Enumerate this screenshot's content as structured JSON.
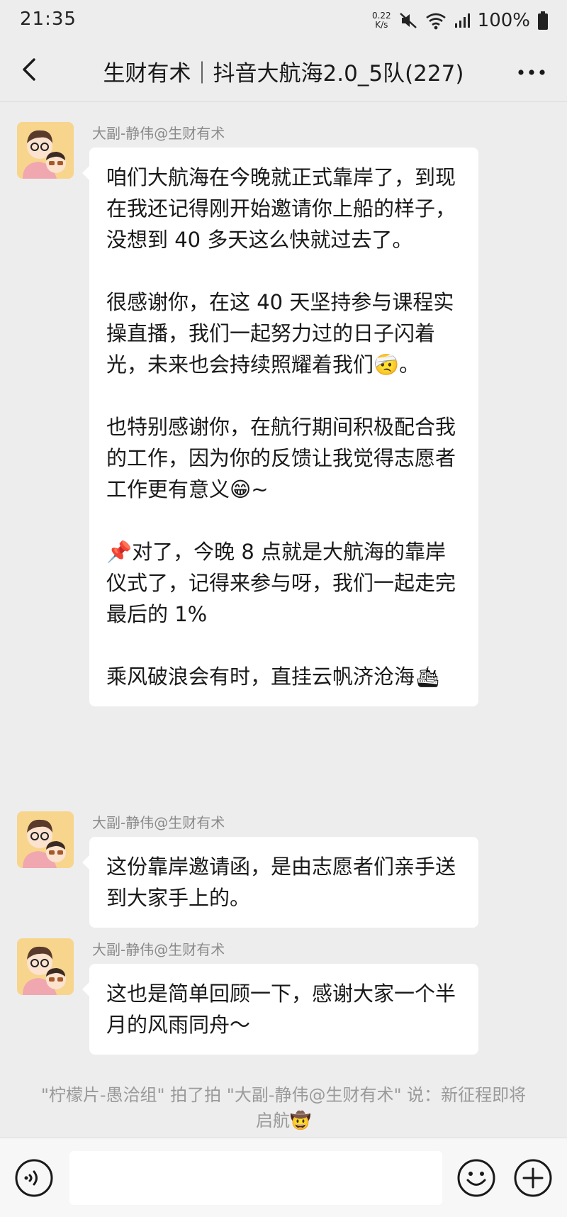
{
  "status_bar": {
    "time": "21:35",
    "net_speed_value": "0.22",
    "net_speed_unit": "K/s",
    "battery": "100%"
  },
  "header": {
    "title": "生财有术｜抖音大航海2.0_5队(227)"
  },
  "messages": [
    {
      "sender": "大副-静伟@生财有术",
      "paragraphs": [
        "咱们大航海在今晚就正式靠岸了，到现在我还记得刚开始邀请你上船的样子，没想到 40 多天这么快就过去了。",
        "很感谢你，在这 40 天坚持参与课程实操直播，我们一起努力过的日子闪着光，未来也会持续照耀着我们🤕。",
        "也特别感谢你，在航行期间积极配合我的工作，因为你的反馈让我觉得志愿者工作更有意义😁~",
        "📌对了，今晚 8 点就是大航海的靠岸仪式了，记得来参与呀，我们一起走完最后的 1%",
        "乘风破浪会有时，直挂云帆济沧海🛳"
      ]
    },
    {
      "sender": "大副-静伟@生财有术",
      "text": "这份靠岸邀请函，是由志愿者们亲手送到大家手上的。"
    },
    {
      "sender": "大副-静伟@生财有术",
      "text": "这也是简单回顾一下，感谢大家一个半月的风雨同舟～"
    }
  ],
  "system_note": "\"柠檬片-愚洽组\" 拍了拍 \"大副-静伟@生财有术\" 说：新征程即将启航🤠",
  "colors": {
    "background": "#ededed",
    "bubble": "#ffffff",
    "sender_text": "#8a8a8a",
    "system_text": "#9a9a9a"
  },
  "icons": {
    "back": "chevron-left-icon",
    "more": "more-horizontal-icon",
    "voice": "voice-icon",
    "emoji": "smiley-icon",
    "plus": "plus-circle-icon"
  }
}
